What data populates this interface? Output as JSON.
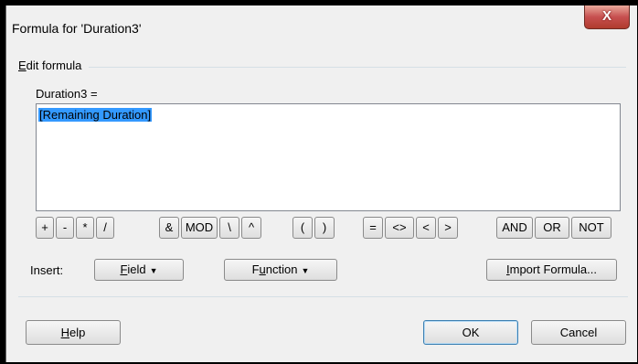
{
  "window": {
    "title": "Formula for 'Duration3'",
    "close_label": "X"
  },
  "group": {
    "label_mnemonic": "E",
    "label_rest": "dit formula"
  },
  "formula": {
    "field_label": "Duration3 =",
    "value": "[Remaining Duration]"
  },
  "operators": [
    "+",
    "-",
    "*",
    "/",
    "&",
    "MOD",
    "\\",
    "^",
    "(",
    ")",
    "=",
    "<>",
    "<",
    ">",
    "AND",
    "OR",
    "NOT"
  ],
  "insert": {
    "label": "Insert:",
    "field_button": {
      "mnemonic": "F",
      "rest": "ield",
      "arrow": "▼"
    },
    "function_button": {
      "pre": "F",
      "mnemonic": "u",
      "rest": "nction",
      "arrow": "▼"
    },
    "import_button": {
      "mnemonic": "I",
      "rest": "mport Formula..."
    }
  },
  "footer": {
    "help": {
      "mnemonic": "H",
      "rest": "elp"
    },
    "ok": "OK",
    "cancel": "Cancel"
  }
}
